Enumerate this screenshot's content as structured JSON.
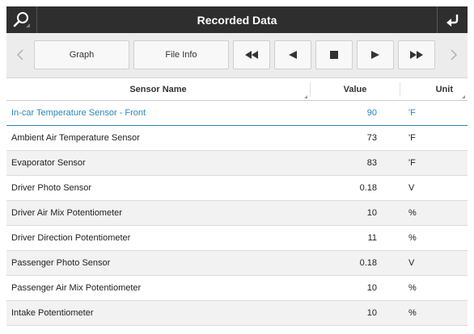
{
  "header": {
    "title": "Recorded Data",
    "left_icon": "search-icon",
    "right_icon": "back-return-icon"
  },
  "toolbar": {
    "graph_label": "Graph",
    "file_info_label": "File Info",
    "controls": [
      "rewind-icon",
      "step-back-icon",
      "stop-icon",
      "step-forward-icon",
      "fast-forward-icon"
    ]
  },
  "table": {
    "columns": [
      "Sensor Name",
      "Value",
      "Unit"
    ],
    "rows": [
      {
        "name": "In-car Temperature Sensor - Front",
        "value": "90",
        "unit": "'F",
        "selected": true
      },
      {
        "name": "Ambient Air Temperature Sensor",
        "value": "73",
        "unit": "'F"
      },
      {
        "name": "Evaporator Sensor",
        "value": "83",
        "unit": "'F"
      },
      {
        "name": "Driver Photo Sensor",
        "value": "0.18",
        "unit": "V"
      },
      {
        "name": "Driver Air Mix Potentiometer",
        "value": "10",
        "unit": "%"
      },
      {
        "name": "Driver Direction Potentiometer",
        "value": "11",
        "unit": "%"
      },
      {
        "name": "Passenger Photo Sensor",
        "value": "0.18",
        "unit": "V"
      },
      {
        "name": "Passenger Air Mix Potentiometer",
        "value": "10",
        "unit": "%"
      },
      {
        "name": "Intake Potentiometer",
        "value": "10",
        "unit": "%"
      }
    ]
  },
  "colors": {
    "titlebar": "#2e2e2e",
    "selected_text": "#2a86b8",
    "alt_row": "#f2f2f2"
  }
}
